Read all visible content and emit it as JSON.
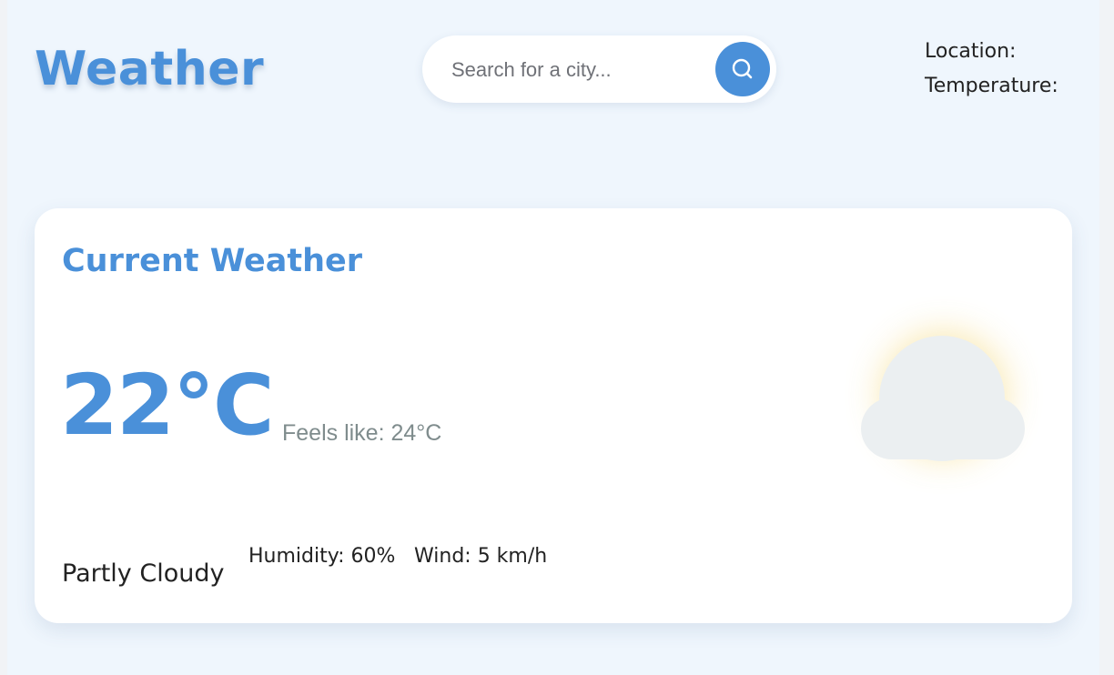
{
  "header": {
    "brand_title": "Weather",
    "search_placeholder": "Search for a city...",
    "search_button_icon": "search-icon",
    "location_label": "Location:",
    "temperature_label": "Temperature:"
  },
  "current_weather": {
    "title": "Current Weather",
    "temperature": "22°C",
    "feels_like": "Feels like: 24°C",
    "condition": "Partly Cloudy",
    "humidity": "Humidity: 60%",
    "wind": "Wind: 5 km/h",
    "icon": "partly-cloudy-icon"
  },
  "colors": {
    "accent": "#4a90d9",
    "page_background": "#eff6fd",
    "card_background": "#ffffff",
    "sun": "#f0c940",
    "cloud": "#ebeff1",
    "muted_text": "#7f8c8d"
  }
}
